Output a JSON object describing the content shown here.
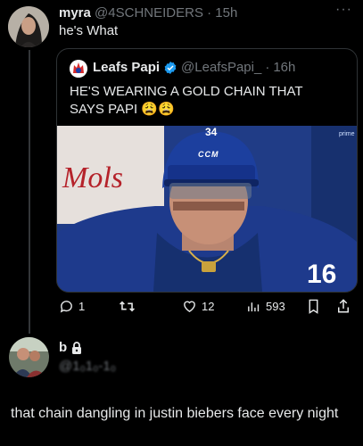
{
  "tweet1": {
    "display_name": "myra",
    "handle": "@4SCHNEIDERS",
    "separator": "·",
    "time": "15h",
    "text": "he's What",
    "more": "···"
  },
  "quoted": {
    "display_name": "Leafs Papi",
    "handle": "@LeafsPapi_",
    "separator": "·",
    "time": "16h",
    "text": "HE'S WEARING A GOLD CHAIN THAT SAYS PAPI 😩😩",
    "media": {
      "helmet_number": "34",
      "helmet_logo": "CCM",
      "jersey_number": "16",
      "bg_sign": "Mols",
      "badge": "prime"
    }
  },
  "actions": {
    "replies": "1",
    "reposts": "",
    "likes": "12",
    "views": "593"
  },
  "tweet2": {
    "display_name": "b",
    "handle": "@1₀1₀-1₀",
    "text": "that chain dangling in justin biebers face every night"
  },
  "colors": {
    "background": "#000000",
    "text": "#e7e9ea",
    "muted": "#71767b",
    "border": "#2f3336",
    "verified": "#1d9bf0"
  }
}
